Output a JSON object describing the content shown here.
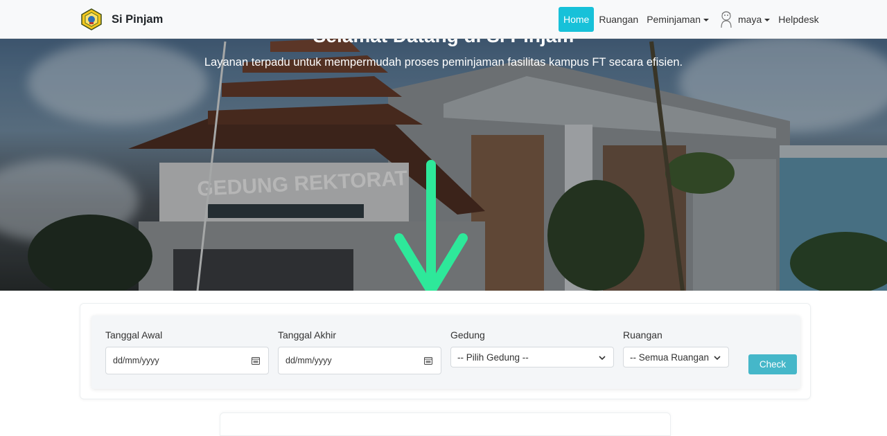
{
  "brand": {
    "name": "Si Pinjam",
    "logo_icon": "university-emblem-icon"
  },
  "nav": {
    "home": "Home",
    "ruangan": "Ruangan",
    "peminjaman": "Peminjaman",
    "user": "maya",
    "helpdesk": "Helpdesk",
    "active_color": "#17c1d9"
  },
  "hero": {
    "title": "Selamat Datang di Si Pinjam",
    "subtitle": "Layanan terpadu untuk mempermudah proses peminjaman fasilitas kampus FT secara efisien.",
    "building_sign": "GEDUNG REKTORAT",
    "arrow_color": "#2ee89a"
  },
  "search": {
    "tanggal_awal": {
      "label": "Tanggal Awal",
      "placeholder": "dd/mm/yyyy"
    },
    "tanggal_akhir": {
      "label": "Tanggal Akhir",
      "placeholder": "dd/mm/yyyy"
    },
    "gedung": {
      "label": "Gedung",
      "selected": "-- Pilih Gedung --"
    },
    "ruangan": {
      "label": "Ruangan",
      "selected": "-- Semua Ruangan"
    },
    "check_label": "Check",
    "check_color": "#45b7c9"
  }
}
